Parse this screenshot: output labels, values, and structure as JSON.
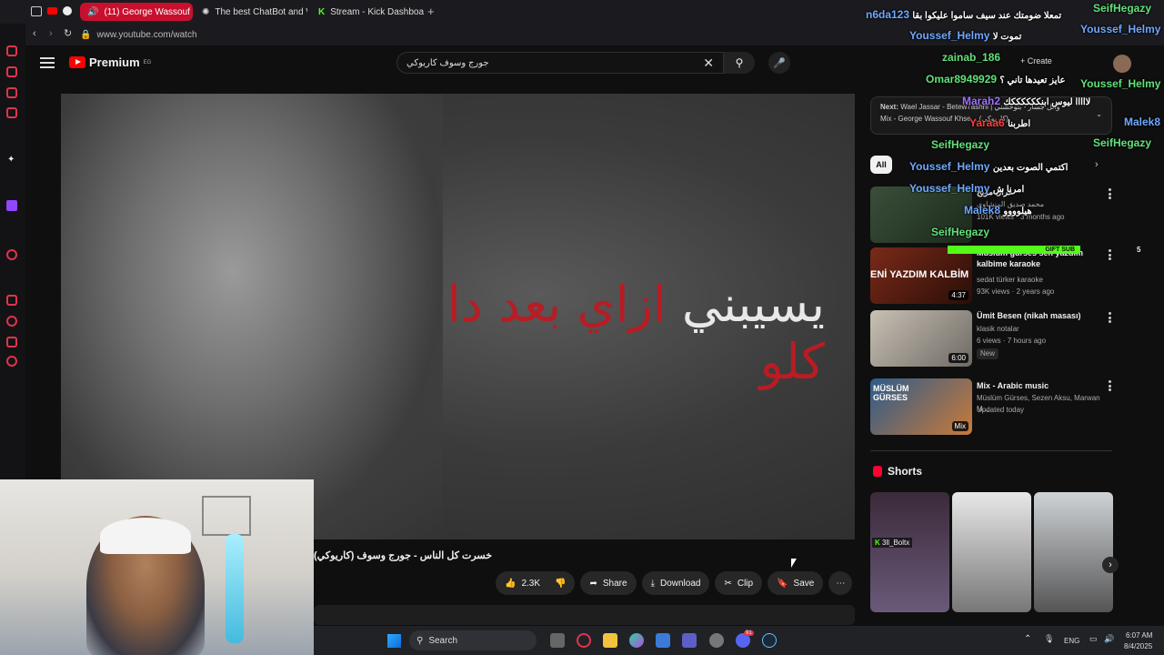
{
  "browser": {
    "tabs": [
      {
        "label": "(11) George Wassouf K"
      },
      {
        "label": "The best ChatBot and W"
      },
      {
        "label": "Stream - Kick Dashboard"
      }
    ],
    "url": "www.youtube.com/watch"
  },
  "youtube": {
    "logo_text": "Premium",
    "logo_badge": "EG",
    "search_value": "جورج وسوف كاريوكي",
    "lyric_red": "ازاي بعد دا كلو",
    "lyric_white": "يسيبني",
    "video_title": "خسرت كل الناس - جورج وسوف (كاريوكي)",
    "actions": {
      "likes": "2.3K",
      "share": "Share",
      "download": "Download",
      "clip": "Clip",
      "save": "Save"
    },
    "create_label": "Create",
    "next": {
      "label": "Next:",
      "title": "Wael Jassar - Betew7ashni | وائل جسار - بتوحشني",
      "sub": "Mix - George Wassouf Khse... (كاريوكي)"
    },
    "chip_all": "All",
    "recommendations": [
      {
        "title": "قران مربح",
        "meta1": "محمد صديق المنشاوي",
        "meta2": "101K views · 3 months ago",
        "duration": ""
      },
      {
        "title": "Müslüm gürses sen yazdım kalbime karaoke",
        "meta1": "sedat türker karaoke",
        "meta2": "93K views · 2 years ago",
        "duration": "4:37",
        "thumb_text": "ENİ YAZDIM KALBİM"
      },
      {
        "title": "Ümit Besen (nikah masası)",
        "meta1": "klasik notalar",
        "meta2": "6 views · 7 hours ago",
        "badge": "New",
        "duration": "6:00"
      },
      {
        "title": "Mix - Arabic music",
        "meta1": "Müslüm Gürses, Sezen Aksu, Marwan M...",
        "meta2": "Updated today",
        "duration": "Mix",
        "thumb_text": "MÜSLÜM GÜRSES"
      }
    ],
    "shorts_title": "Shorts"
  },
  "chat": [
    {
      "user": "SeifHegazy",
      "msg": "",
      "color": "green"
    },
    {
      "user": "n6da123",
      "msg": "تمعلا ضومتك عند سيف ساموا عليكوا بقا",
      "color": "blue"
    },
    {
      "user": "Youssef_Helmy",
      "msg": "",
      "color": "green"
    },
    {
      "user": "Youssef_Helmy",
      "msg": "تموت لا",
      "color": "blue"
    },
    {
      "user": "zainab_186",
      "msg": "",
      "color": "green"
    },
    {
      "user": "Omar8949929",
      "msg": "عايز تعيدها تاني ؟",
      "color": "green"
    },
    {
      "user": "Youssef_Helmy",
      "msg": "",
      "color": "green"
    },
    {
      "user": "Marah2",
      "msg": "لااااا ليوس ابنككككككك",
      "color": "blue"
    },
    {
      "user": "Malek8",
      "msg": "",
      "color": "blue"
    },
    {
      "user": "Yaraa6",
      "msg": "اطربنا",
      "color": "red"
    },
    {
      "user": "SeifHegazy",
      "msg": "",
      "color": "green"
    },
    {
      "user": "SeifHegazy",
      "msg": "",
      "color": "green"
    },
    {
      "user": "Youssef_Helmy",
      "msg": "اكتمي الصوت بعدين",
      "color": "blue"
    },
    {
      "user": "Youssef_Helmy",
      "msg": "امرنا ش",
      "color": "blue"
    },
    {
      "user": "Malek8",
      "msg": "هيلوووو",
      "color": "blue"
    },
    {
      "user": "SeifHegazy",
      "msg": "",
      "color": "green"
    }
  ],
  "stream_overlay": {
    "gift_label": "GIFT SUB",
    "gift_count": "5",
    "webcam_name": "3ll_Boltx"
  },
  "taskbar": {
    "search_label": "Search",
    "language": "ENG",
    "time": "6:07 AM",
    "date": "8/4/2025",
    "badge": "91"
  }
}
